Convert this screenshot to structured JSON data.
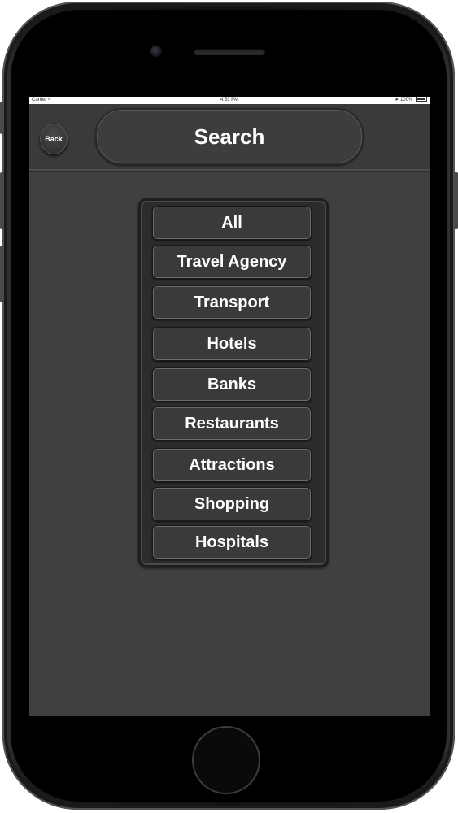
{
  "status_bar": {
    "carrier": "Carrier",
    "wifi_icon": "wifi-icon",
    "time": "4:53 PM",
    "battery_percent": "100%"
  },
  "nav": {
    "back_label": "Back",
    "title": "Search"
  },
  "categories": [
    {
      "label": "All"
    },
    {
      "label": "Travel Agency"
    },
    {
      "label": "Transport"
    },
    {
      "label": "Hotels"
    },
    {
      "label": "Banks"
    },
    {
      "label": "Restaurants"
    },
    {
      "label": "Attractions"
    },
    {
      "label": "Shopping"
    },
    {
      "label": "Hospitals"
    }
  ],
  "colors": {
    "screen_bg": "#404040",
    "button_bg": "#3a3a3a",
    "text": "#ffffff"
  }
}
